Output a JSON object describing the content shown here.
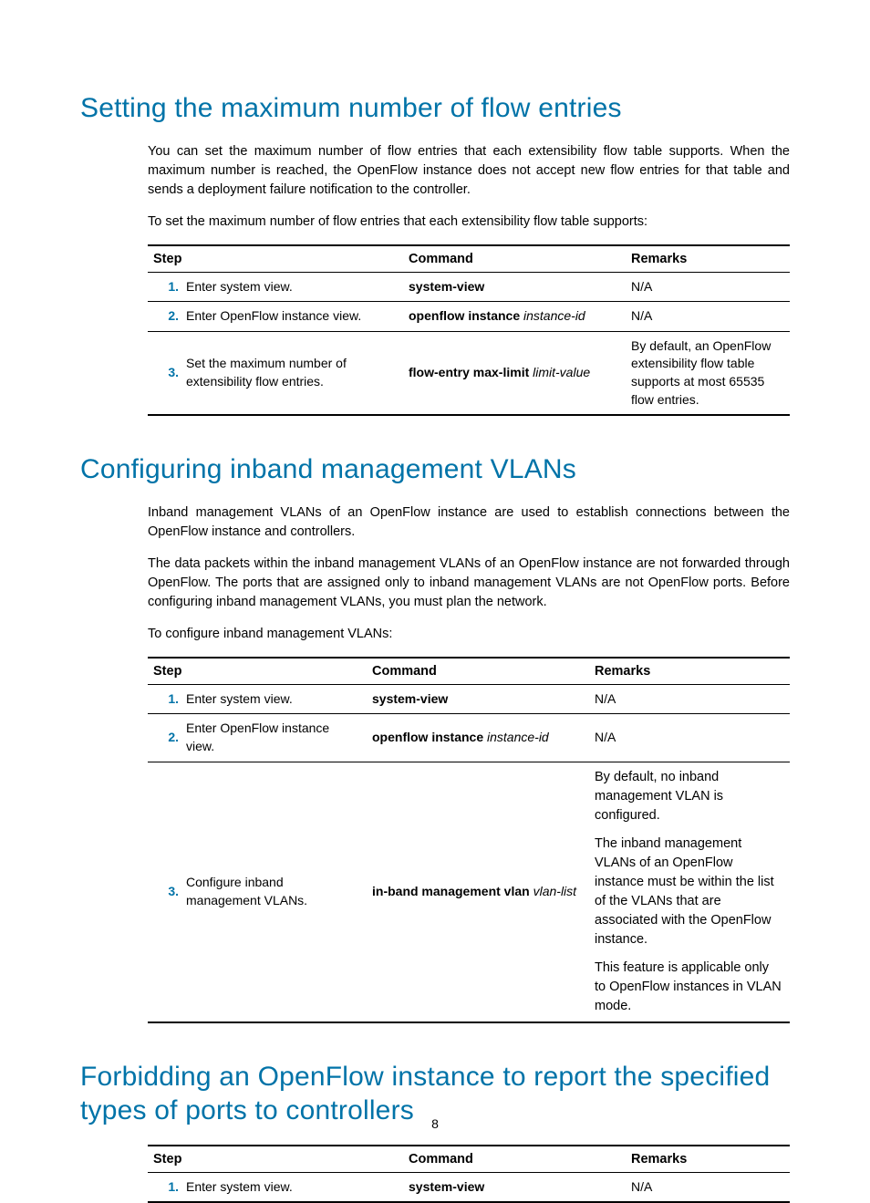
{
  "page_number": "8",
  "section1": {
    "heading": "Setting the maximum number of flow entries",
    "para1": "You can set the maximum number of flow entries that each extensibility flow table supports. When the maximum number is reached, the OpenFlow instance does not accept new flow entries for that table and sends a deployment failure notification to the controller.",
    "para2": "To set the maximum number of flow entries that each extensibility flow table supports:",
    "table": {
      "headers": {
        "step": "Step",
        "command": "Command",
        "remarks": "Remarks"
      },
      "rows": [
        {
          "num": "1.",
          "step": "Enter system view.",
          "cmd_bold": "system-view",
          "cmd_ital": "",
          "remarks": "N/A"
        },
        {
          "num": "2.",
          "step": "Enter OpenFlow instance view.",
          "cmd_bold": "openflow instance",
          "cmd_ital": " instance-id",
          "remarks": "N/A"
        },
        {
          "num": "3.",
          "step": "Set the maximum number of extensibility flow entries.",
          "cmd_bold": "flow-entry max-limit",
          "cmd_ital": " limit-value",
          "remarks": "By default, an OpenFlow extensibility flow table supports at most 65535 flow entries."
        }
      ]
    }
  },
  "section2": {
    "heading": "Configuring inband management VLANs",
    "para1": "Inband management VLANs of an OpenFlow instance are used to establish connections between the OpenFlow instance and controllers.",
    "para2": "The data packets within the inband management VLANs of an OpenFlow instance are not forwarded through OpenFlow. The ports that are assigned only to inband management VLANs are not OpenFlow ports. Before configuring inband management VLANs, you must plan the network.",
    "para3": "To configure inband management VLANs:",
    "table": {
      "headers": {
        "step": "Step",
        "command": "Command",
        "remarks": "Remarks"
      },
      "rows": [
        {
          "num": "1.",
          "step": "Enter system view.",
          "cmd_bold": "system-view",
          "cmd_ital": "",
          "remarks": "N/A"
        },
        {
          "num": "2.",
          "step": "Enter OpenFlow instance view.",
          "cmd_bold": "openflow instance",
          "cmd_ital": " instance-id",
          "remarks": "N/A"
        },
        {
          "num": "3.",
          "step": "Configure inband management VLANs.",
          "cmd_bold": "in-band management vlan",
          "cmd_ital": " vlan-list",
          "remarks_multi": [
            "By default, no inband management VLAN is configured.",
            "The inband management VLANs of an OpenFlow instance must be within the list of the VLANs that are associated with the OpenFlow instance.",
            "This feature is applicable only to OpenFlow instances in VLAN mode."
          ]
        }
      ]
    }
  },
  "section3": {
    "heading": "Forbidding an OpenFlow instance to report the specified types of ports to controllers",
    "table": {
      "headers": {
        "step": "Step",
        "command": "Command",
        "remarks": "Remarks"
      },
      "rows": [
        {
          "num": "1.",
          "step": "Enter system view.",
          "cmd_bold": "system-view",
          "cmd_ital": "",
          "remarks": "N/A"
        }
      ]
    }
  }
}
